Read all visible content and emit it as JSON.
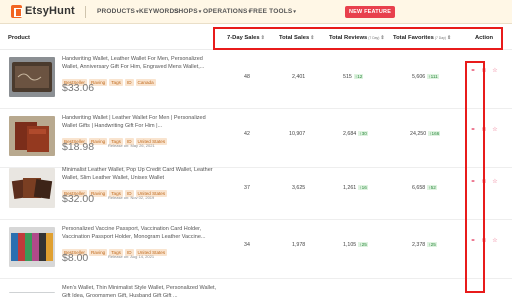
{
  "nav": {
    "brand": "EtsyHunt",
    "items": [
      {
        "label": "PRODUCTS",
        "caret": "▾"
      },
      {
        "label": "KEYWORDS",
        "caret": ""
      },
      {
        "label": "SHOPS",
        "caret": "▾"
      },
      {
        "label": "OPERATIONS",
        "caret": "▾"
      },
      {
        "label": "FREE TOOLS",
        "caret": "▾"
      }
    ],
    "feature_button": "NEW FEATURE",
    "accent": "#e8404d",
    "brand_color": "#f26522"
  },
  "table": {
    "headers": {
      "product": "Product",
      "sales7": "7-Day Sales",
      "total_sales": "Total Sales",
      "total_reviews": "Total Reviews",
      "total_reviews_sub": "(7 Day)",
      "total_favorites": "Total Favorites",
      "total_favorites_sub": "(7 Day)",
      "action": "Action",
      "sort_glyph": "⇕"
    },
    "rows": [
      {
        "title": "Handwriting Wallet, Leather Wallet For Men, Personalized Wallet, Anniversary Gift For Him, Engraved Mens Wallet,...",
        "tags": [
          "BestSeller",
          "Raving",
          "Tags",
          "ID",
          "Canada"
        ],
        "price": "$33.06",
        "release": "",
        "sales7": "48",
        "total_sales": "2,401",
        "reviews": "515",
        "reviews_delta": "↑12",
        "favorites": "5,606",
        "favorites_delta": "↑111"
      },
      {
        "title": "Handwriting Wallet | Leather Wallet For Men | Personalized Wallet Gifts | Handwriting Gift For Him |...",
        "tags": [
          "BestSeller",
          "Raving",
          "Tags",
          "ID",
          "United States"
        ],
        "price": "$18.98",
        "release": "Release on: May 26, 2021",
        "sales7": "42",
        "total_sales": "10,907",
        "reviews": "2,684",
        "reviews_delta": "↑30",
        "favorites": "24,250",
        "favorites_delta": "↑166"
      },
      {
        "title": "Minimalist Leather Wallet, Pop Up Credit Card Wallet, Leather Wallet, Slim Leather Wallet, Unisex Wallet",
        "tags": [
          "BestSeller",
          "Raving",
          "Tags",
          "ID",
          "United States"
        ],
        "price": "$32.00",
        "release": "Release on: Nov 02, 2019",
        "sales7": "37",
        "total_sales": "3,625",
        "reviews": "1,261",
        "reviews_delta": "↑16",
        "favorites": "6,658",
        "favorites_delta": "↑52"
      },
      {
        "title": "Personalized Vaccine Passport, Vaccination Card Holder, Vaccination Passport Holder, Monogram Leather Vaccine...",
        "tags": [
          "BestSeller",
          "Raving",
          "Tags",
          "ID",
          "United States"
        ],
        "price": "$8.00",
        "release": "Release on: Aug 14, 2021",
        "sales7": "34",
        "total_sales": "1,978",
        "reviews": "1,105",
        "reviews_delta": "↑25",
        "favorites": "2,378",
        "favorites_delta": "↑25"
      },
      {
        "title": "Men's Wallet, Thin Minimalist Style Wallet, Personalized Wallet, Gift Idea, Groomsmen Gift, Husband Gift Gift ...",
        "tags": [],
        "price": "",
        "release": "",
        "sales7": "",
        "total_sales": "",
        "reviews": "",
        "reviews_delta": "",
        "favorites": "",
        "favorites_delta": ""
      }
    ],
    "action_icons": [
      "link-icon",
      "trend-icon",
      "star-icon"
    ],
    "highlight_color": "#e81b1b"
  }
}
